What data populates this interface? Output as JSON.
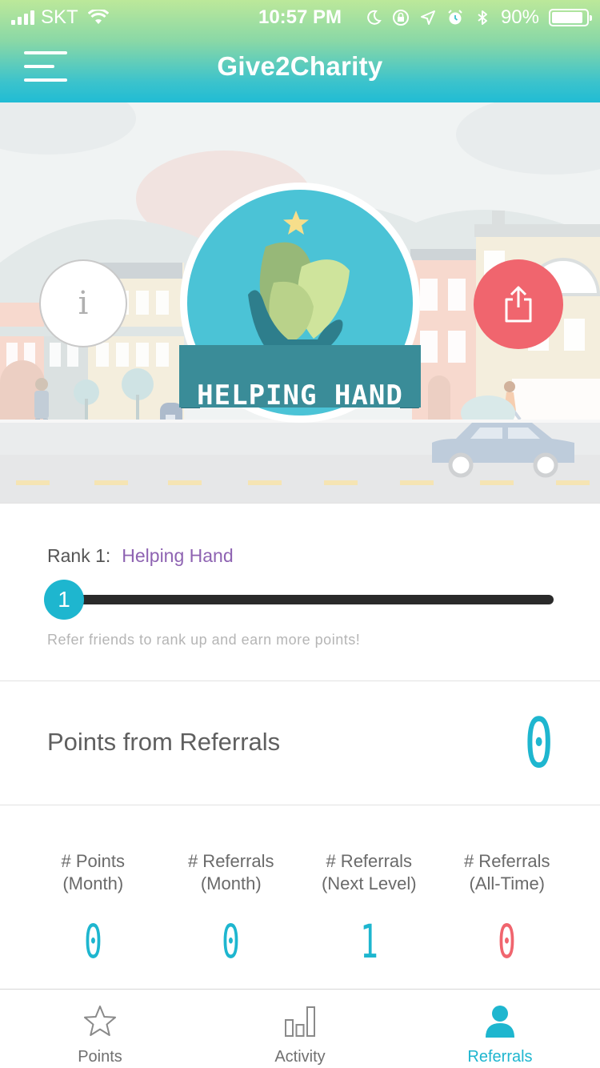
{
  "status_bar": {
    "carrier": "SKT",
    "time": "10:57 PM",
    "battery": "90%",
    "battery_level": 0.9
  },
  "header": {
    "title": "Give2Charity"
  },
  "hero": {
    "badge_title": "HELPING HAND",
    "info_label": "i"
  },
  "rank": {
    "label": "Rank 1:",
    "name": "Helping Hand",
    "level": "1",
    "progress": 0,
    "hint": "Refer friends to rank up and earn more points!"
  },
  "points_from_referrals": {
    "label": "Points from Referrals",
    "value": "0"
  },
  "stats": [
    {
      "label_line1": "# Points",
      "label_line2": "(Month)",
      "value": "0"
    },
    {
      "label_line1": "# Referrals",
      "label_line2": "(Month)",
      "value": "0"
    },
    {
      "label_line1": "# Referrals",
      "label_line2": "(Next Level)",
      "value": "1"
    },
    {
      "label_line1": "# Referrals",
      "label_line2": "(All-Time)",
      "value": "0"
    }
  ],
  "tabs": [
    {
      "label": "Points",
      "icon": "star-icon",
      "active": false
    },
    {
      "label": "Activity",
      "icon": "bar-chart-icon",
      "active": false
    },
    {
      "label": "Referrals",
      "icon": "person-icon",
      "active": true
    }
  ],
  "colors": {
    "accent": "#1eb6cf",
    "share": "#f0656e",
    "rank_name": "#8e63b2",
    "all_time_value": "#f0656e"
  }
}
